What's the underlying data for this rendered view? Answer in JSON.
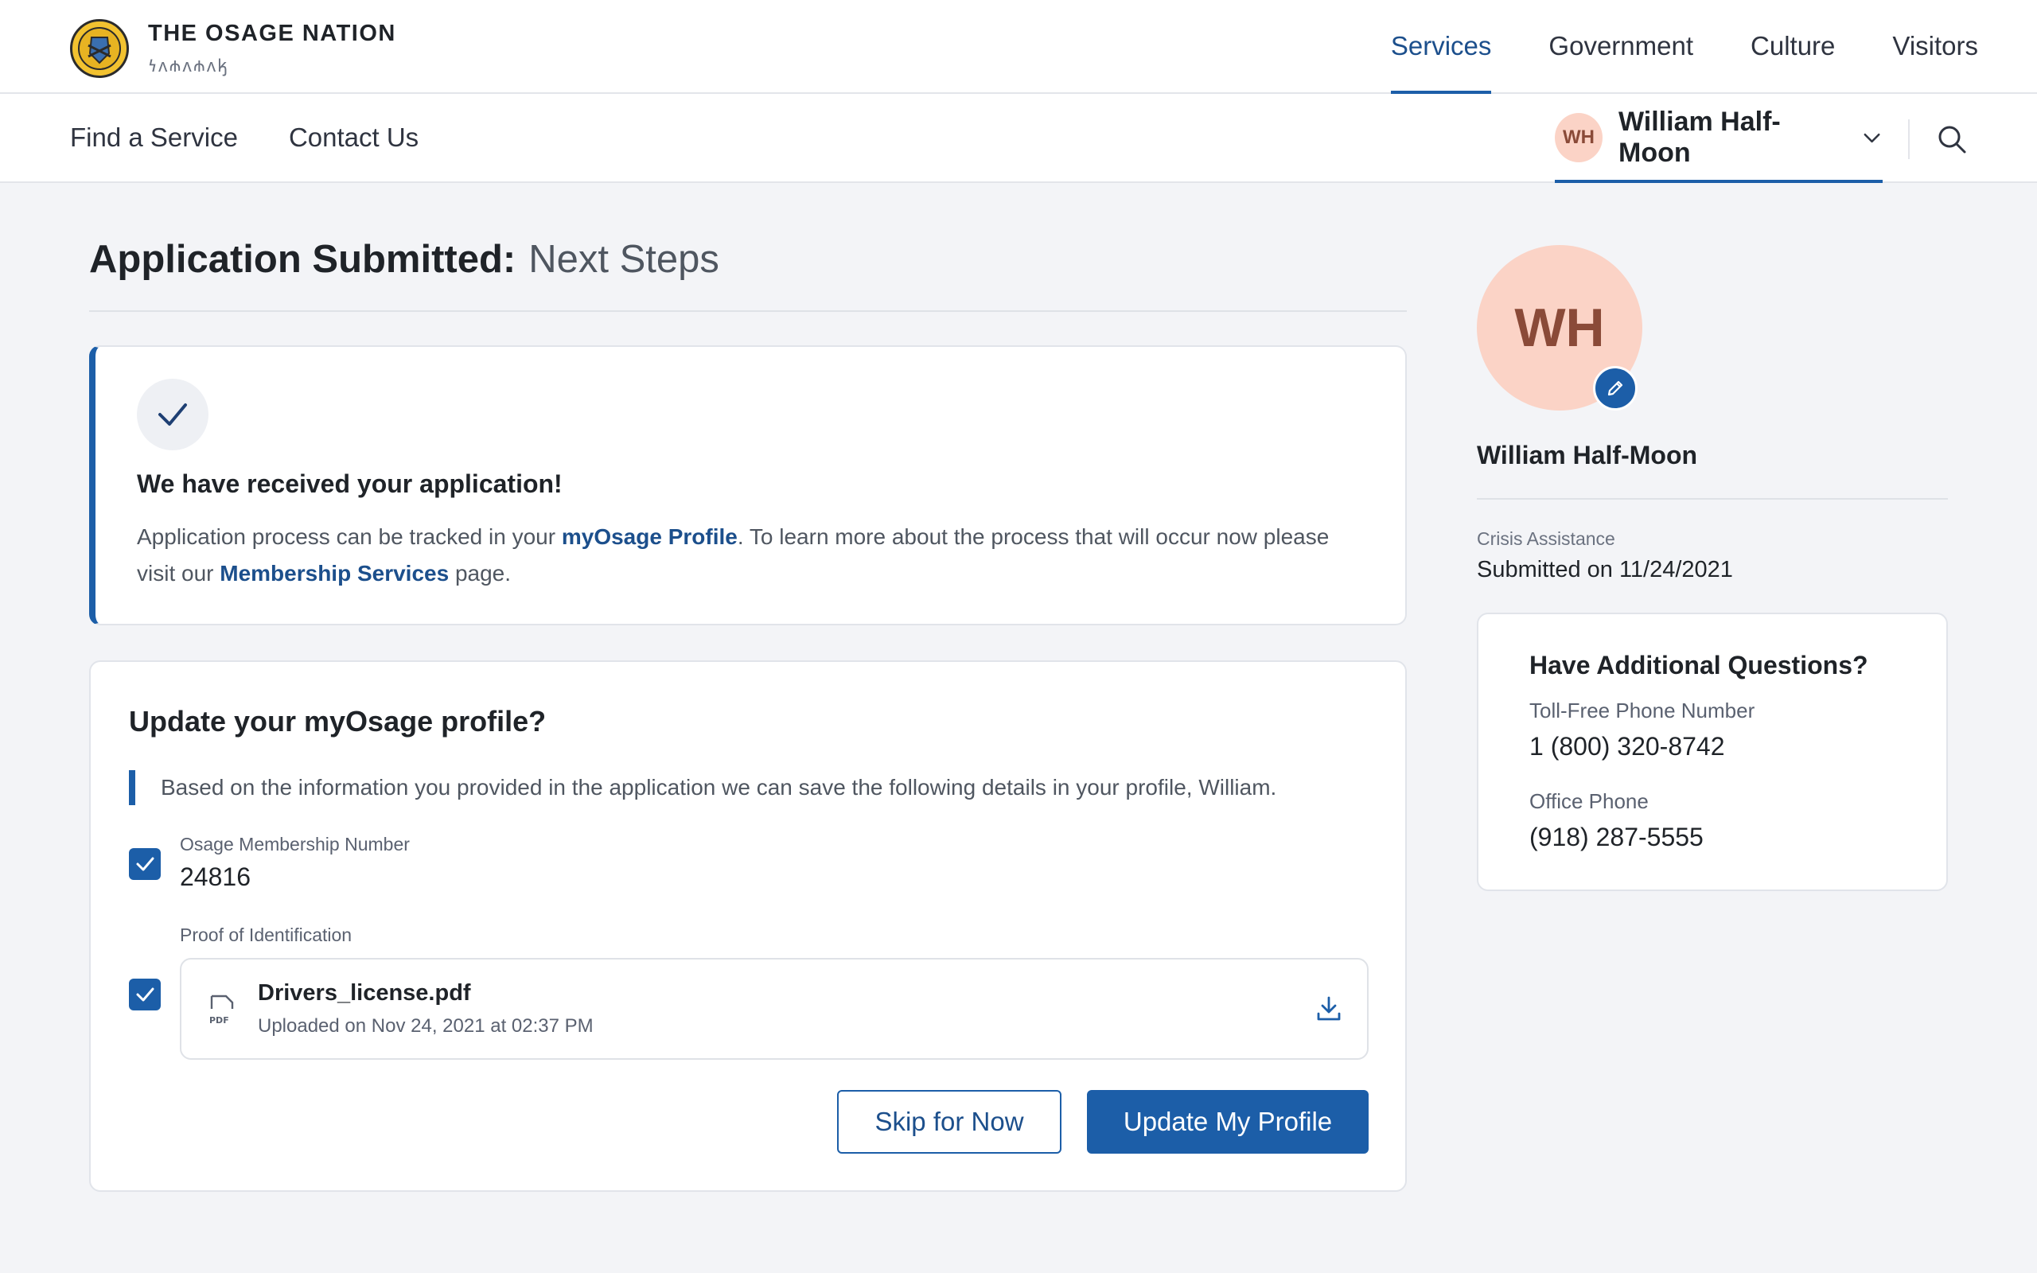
{
  "brand": {
    "title": "THE OSAGE NATION",
    "subtitle": "𐓏𐓘𐓸𐓘𐓸𐓘𐓤"
  },
  "main_nav": [
    "Services",
    "Government",
    "Culture",
    "Visitors"
  ],
  "sub_nav": [
    "Find a Service",
    "Contact Us"
  ],
  "user": {
    "initials": "WH",
    "name": "William Half-Moon"
  },
  "page": {
    "title": "Application Submitted:",
    "subtitle": "Next Steps"
  },
  "notice": {
    "title": "We have received your application!",
    "body_1": "Application process can be tracked in your ",
    "link_1": "myOsage Profile",
    "body_2": ". To learn more about the process that will occur now please visit our ",
    "link_2": "Membership Services",
    "body_3": " page."
  },
  "profile_update": {
    "title": "Update your myOsage profile?",
    "note": "Based on the information you provided in the application we can save the following details in your profile, William.",
    "membership_label": "Osage Membership Number",
    "membership_value": "24816",
    "membership_checked": true,
    "proof_label": "Proof of Identification",
    "proof_checked": true,
    "file_name": "Drivers_license.pdf",
    "file_meta": "Uploaded on Nov 24, 2021 at 02:37 PM",
    "file_badge": "PDF",
    "skip_label": "Skip for Now",
    "update_label": "Update My Profile"
  },
  "sidebar": {
    "initials": "WH",
    "name": "William Half-Moon",
    "application_type": "Crisis Assistance",
    "submitted": "Submitted on 11/24/2021",
    "questions_title": "Have Additional Questions?",
    "tollfree_label": "Toll-Free Phone Number",
    "tollfree_value": "1 (800) 320-8742",
    "office_label": "Office Phone",
    "office_value": "(918) 287-5555"
  },
  "colors": {
    "accent": "#1c5ea8",
    "link": "#1c4f8c",
    "avatar_bg": "#fbd3c6",
    "seal": "#f2c230"
  }
}
